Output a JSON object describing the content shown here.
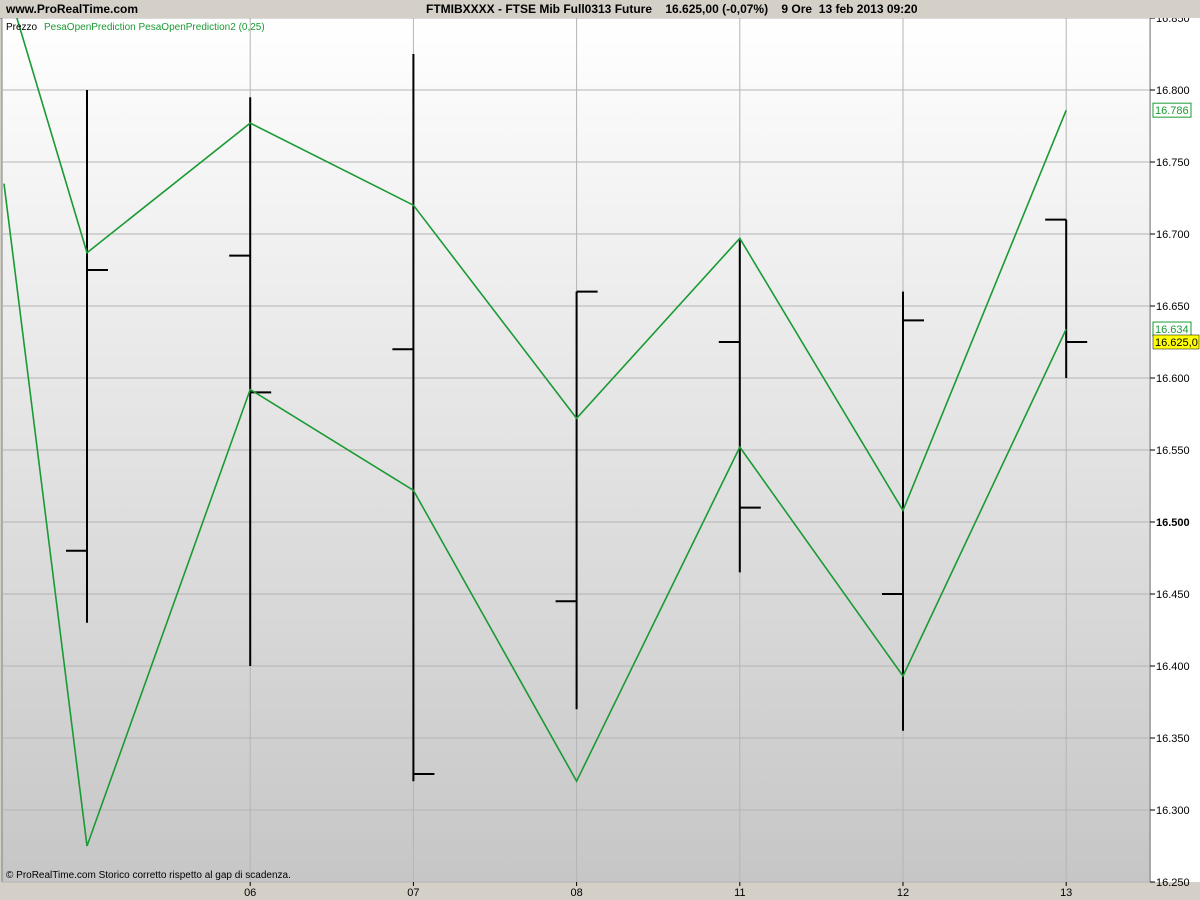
{
  "window": {
    "site": "www.ProRealTime.com",
    "header": "FTMIBXXXX - FTSE Mib Full0313 Future    16.625,00 (-0,07%)    9 Ore  13 feb 2013 09:20"
  },
  "legend": {
    "price_label": "Prezzo",
    "indicator_label": "PesaOpenPrediction PesaOpenPrediction2 (0,25)"
  },
  "footer_note": "© ProRealTime.com  Storico corretto rispetto al gap di scadenza.",
  "colors": {
    "price_bar": "#000000",
    "indicator": "#1a9a33",
    "current_price_tag": "#ffff00",
    "grid": "#b4b4b4"
  },
  "chart_data": {
    "type": "ohlc",
    "x_labels": [
      "",
      "06",
      "07",
      "08",
      "11",
      "12",
      "13"
    ],
    "ylim": [
      16250,
      16850
    ],
    "yticks": [
      16250,
      16300,
      16350,
      16400,
      16450,
      16500,
      16550,
      16600,
      16650,
      16700,
      16750,
      16800,
      16850
    ],
    "ytick_labels": [
      "16.250",
      "16.300",
      "16.350",
      "16.400",
      "16.450",
      "16.500",
      "16.550",
      "16.600",
      "16.650",
      "16.700",
      "16.750",
      "16.800",
      "16.850"
    ],
    "grid": true,
    "ohlc": [
      {
        "open": 16480,
        "high": 16800,
        "low": 16430,
        "close": 16675
      },
      {
        "open": 16685,
        "high": 16795,
        "low": 16400,
        "close": 16590
      },
      {
        "open": 16620,
        "high": 16825,
        "low": 16320,
        "close": 16325
      },
      {
        "open": 16445,
        "high": 16660,
        "low": 16370,
        "close": 16660
      },
      {
        "open": 16625,
        "high": 16697,
        "low": 16465,
        "close": 16510
      },
      {
        "open": 16450,
        "high": 16660,
        "low": 16355,
        "close": 16640
      },
      {
        "open": 16710,
        "high": 16710,
        "low": 16600,
        "close": 16625
      }
    ],
    "series": [
      {
        "values": [
          16880,
          16687,
          16777,
          16720,
          16572,
          16697,
          16508,
          16786
        ]
      },
      {
        "values": [
          16735,
          16275,
          16592,
          16522,
          16320,
          16552,
          16393,
          16634
        ]
      }
    ],
    "series_x_slots": [
      -1.5,
      0,
      1,
      2,
      3,
      4,
      5,
      6
    ],
    "price_tags": [
      {
        "value": 16786,
        "label": "16.786",
        "style": "indicator"
      },
      {
        "value": 16634,
        "label": "16.634",
        "style": "indicator"
      },
      {
        "value": 16625,
        "label": "16.625,0",
        "style": "current"
      }
    ]
  }
}
